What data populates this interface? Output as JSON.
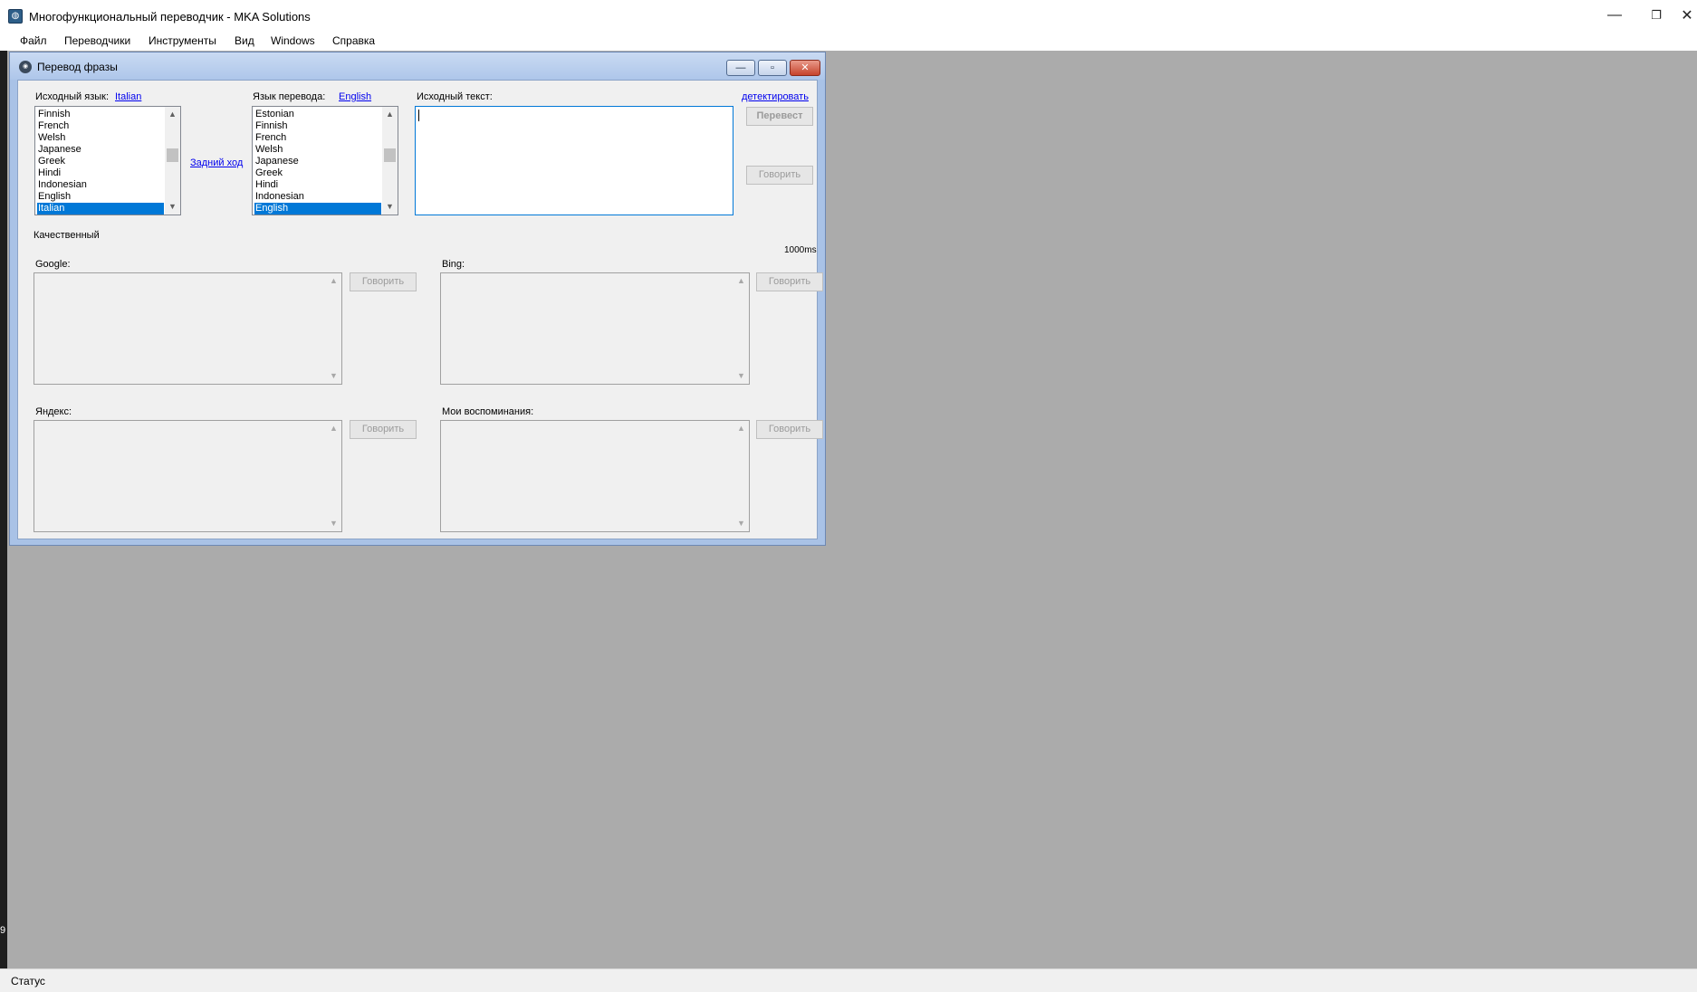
{
  "app": {
    "title": "Многофункциональный переводчик - MKA Solutions",
    "icon": "globe-icon",
    "controls": {
      "minimize": "—",
      "restore": "❐",
      "close": "✕"
    }
  },
  "menu": [
    "Файл",
    "Переводчики",
    "Инструменты",
    "Вид",
    "Windows",
    "Справка"
  ],
  "left_edge_text": "9",
  "child": {
    "title": "Перевод фразы",
    "controls": {
      "minimize": "—",
      "restore": "▫",
      "close": "✕"
    },
    "source_lang_label": "Исходный язык:",
    "source_lang_value": "Italian",
    "source_list": [
      "Finnish",
      "French",
      "Welsh",
      "Japanese",
      "Greek",
      "Hindi",
      "Indonesian",
      "English",
      "Italian"
    ],
    "swap_link": "Задний ход",
    "target_lang_label": "Язык перевода:",
    "target_lang_value": "English",
    "target_list": [
      "Estonian",
      "Finnish",
      "French",
      "Welsh",
      "Japanese",
      "Greek",
      "Hindi",
      "Indonesian",
      "English"
    ],
    "source_text_label": "Исходный текст:",
    "source_text_value": "",
    "detect_link": "детектировать",
    "translate_button": "Перевест",
    "speak_source_button": "Говорить",
    "quality_label": "Качественный",
    "timing": "1000ms",
    "panels": [
      {
        "label": "Google:",
        "speak": "Говорить",
        "text": ""
      },
      {
        "label": "Bing:",
        "speak": "Говорить",
        "text": ""
      },
      {
        "label": "Яндекс:",
        "speak": "Говорить",
        "text": ""
      },
      {
        "label": "Мои воспоминания:",
        "speak": "Говорить",
        "text": ""
      }
    ]
  },
  "status": "Статус",
  "colors": {
    "selection": "#0078d7",
    "link": "#0000ee",
    "mdi_background": "#ababab"
  }
}
